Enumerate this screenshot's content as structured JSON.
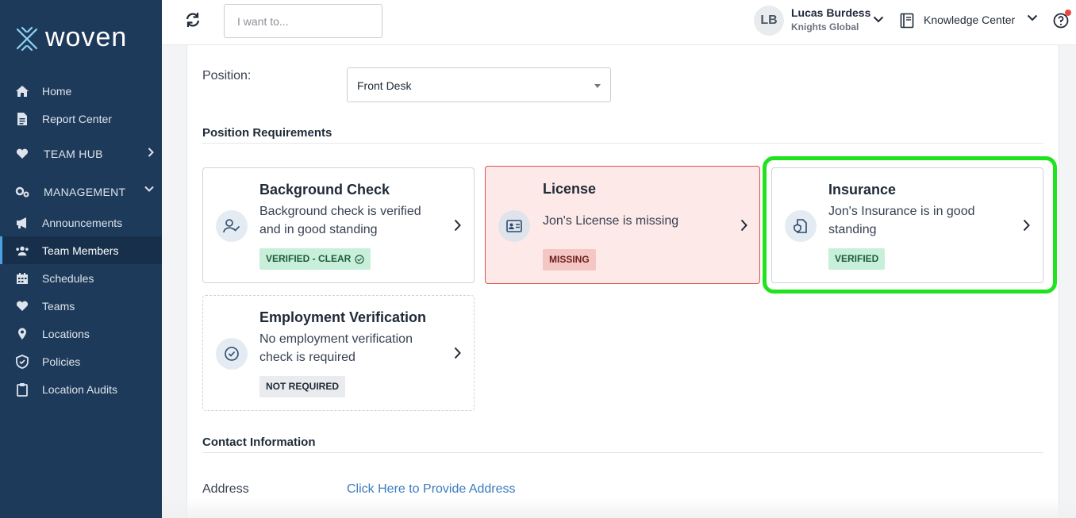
{
  "app": {
    "logo_text": "woven"
  },
  "sidebar": {
    "items": [
      {
        "label": "Home",
        "icon": "home-icon"
      },
      {
        "label": "Report Center",
        "icon": "report-icon"
      },
      {
        "label": "TEAM HUB",
        "icon": "heart-icon"
      },
      {
        "label": "MANAGEMENT",
        "icon": "gears-icon"
      },
      {
        "label": "Announcements",
        "icon": "megaphone-icon"
      },
      {
        "label": "Team Members",
        "icon": "users-icon"
      },
      {
        "label": "Schedules",
        "icon": "calendar-icon"
      },
      {
        "label": "Teams",
        "icon": "heart-icon"
      },
      {
        "label": "Locations",
        "icon": "pin-icon"
      },
      {
        "label": "Policies",
        "icon": "shield-icon"
      },
      {
        "label": "Location Audits",
        "icon": "clipboard-icon"
      }
    ],
    "active": "Team Members"
  },
  "header": {
    "search_placeholder": "I want to...",
    "avatar_initials": "LB",
    "user_name": "Lucas Burdess",
    "user_org": "Knights Global",
    "knowledge_center": "Knowledge Center"
  },
  "main": {
    "position_label": "Position:",
    "position_value": "Front Desk",
    "requirements_title": "Position Requirements",
    "cards": [
      {
        "title": "Background Check",
        "desc": "Background check is verified and in good standing",
        "badge": "VERIFIED - CLEAR",
        "status": "verified"
      },
      {
        "title": "License",
        "desc": "Jon's License is missing",
        "badge": "MISSING",
        "status": "missing"
      },
      {
        "title": "Insurance",
        "desc": "Jon's Insurance is in good standing",
        "badge": "VERIFIED",
        "status": "verified"
      },
      {
        "title": "Employment Verification",
        "desc": "No employment verification check is required",
        "badge": "NOT REQUIRED",
        "status": "not-required"
      }
    ],
    "contact_title": "Contact Information",
    "address_label": "Address",
    "address_link": "Click Here to Provide Address"
  },
  "colors": {
    "sidebar_bg": "#1e3a5a",
    "highlight": "#1ee31e",
    "verified_badge": "#c8efd9",
    "missing_badge": "#f4c6c4",
    "link": "#3b7bbf"
  }
}
